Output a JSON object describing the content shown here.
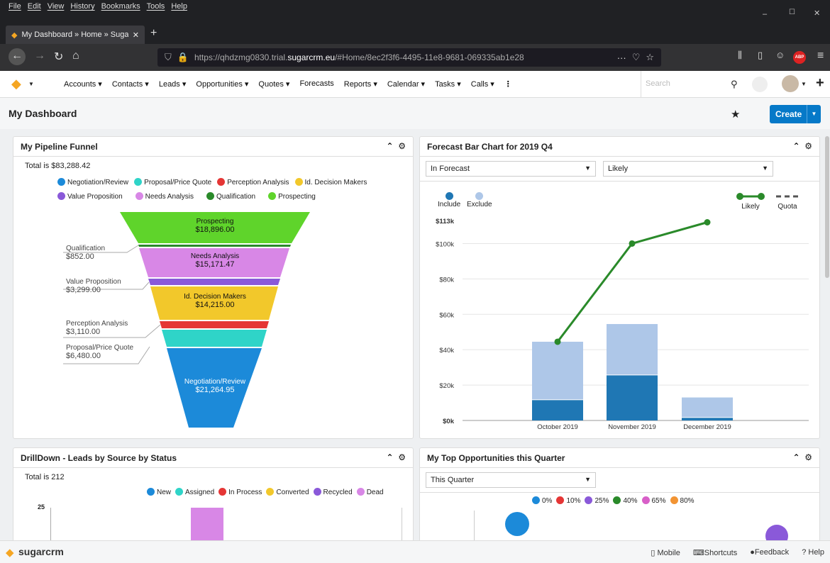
{
  "browser": {
    "menu": [
      "File",
      "Edit",
      "View",
      "History",
      "Bookmarks",
      "Tools",
      "Help"
    ],
    "tab_title": "My Dashboard » Home » Sugar",
    "url_prefix": "https://qhdzmg0830.trial.",
    "url_host": "sugarcrm.eu",
    "url_rest": "/#Home/8ec2f3f6-4495-11e8-9681-069335ab1e28",
    "extra_icon": "ABP"
  },
  "nav": {
    "modules": [
      "Accounts ▾",
      "Contacts ▾",
      "Leads ▾",
      "Opportunities ▾",
      "Quotes ▾",
      "Forecasts",
      "Reports ▾",
      "Calendar ▾",
      "Tasks ▾",
      "Calls ▾",
      "⋮"
    ],
    "search_placeholder": "Search"
  },
  "page": {
    "title": "My Dashboard",
    "create_label": "Create"
  },
  "funnel": {
    "title": "My Pipeline Funnel",
    "total": "Total is $83,288.42",
    "legend_row1": [
      {
        "label": "Negotiation/Review",
        "color": "#1c8ad9"
      },
      {
        "label": "Proposal/Price Quote",
        "color": "#2fd4c8"
      },
      {
        "label": "Perception Analysis",
        "color": "#e53635"
      },
      {
        "label": "Id. Decision Makers",
        "color": "#f2c82b"
      }
    ],
    "legend_row2": [
      {
        "label": "Value Proposition",
        "color": "#8a59d9"
      },
      {
        "label": "Needs Analysis",
        "color": "#d887e6"
      },
      {
        "label": "Qualification",
        "color": "#2a8a2a"
      },
      {
        "label": "Prospecting",
        "color": "#5fd42b"
      }
    ],
    "stages": [
      {
        "name": "Prospecting",
        "value": "$18,896.00"
      },
      {
        "name": "Qualification",
        "value": "$852.00"
      },
      {
        "name": "Needs Analysis",
        "value": "$15,171.47"
      },
      {
        "name": "Value Proposition",
        "value": "$3,299.00"
      },
      {
        "name": "Id. Decision Makers",
        "value": "$14,215.00"
      },
      {
        "name": "Perception Analysis",
        "value": "$3,110.00"
      },
      {
        "name": "Proposal/Price Quote",
        "value": "$6,480.00"
      },
      {
        "name": "Negotiation/Review",
        "value": "$21,264.95"
      }
    ]
  },
  "forecast": {
    "title": "Forecast Bar Chart for 2019 Q4",
    "filter1": "In Forecast",
    "filter2": "Likely",
    "legend_include": "Include",
    "legend_exclude": "Exclude",
    "legend_likely": "Likely",
    "legend_quota": "Quota"
  },
  "chart_data": {
    "type": "bar",
    "categories": [
      "October 2019",
      "November 2019",
      "December 2019"
    ],
    "series": [
      {
        "name": "Include",
        "values": [
          11500,
          25500,
          1500
        ],
        "color": "#1f77b4"
      },
      {
        "name": "Exclude",
        "values": [
          33000,
          29000,
          11500
        ],
        "color": "#aec7e8"
      },
      {
        "name": "Likely",
        "type": "line",
        "values": [
          44500,
          100000,
          112000
        ],
        "color": "#2a8a2a"
      }
    ],
    "yticks": [
      "$0k",
      "$20k",
      "$40k",
      "$60k",
      "$80k",
      "$100k",
      "$113k"
    ],
    "ylim": [
      0,
      113000
    ],
    "stacked": true
  },
  "drilldown": {
    "title": "DrillDown - Leads by Source by Status",
    "total": "Total is 212",
    "legend": [
      {
        "label": "New",
        "color": "#1c8ad9"
      },
      {
        "label": "Assigned",
        "color": "#2fd4c8"
      },
      {
        "label": "In Process",
        "color": "#e53635"
      },
      {
        "label": "Converted",
        "color": "#f2c82b"
      },
      {
        "label": "Recycled",
        "color": "#8a59d9"
      },
      {
        "label": "Dead",
        "color": "#d887e6"
      }
    ],
    "ytick_top": "25"
  },
  "topopps": {
    "title": "My Top Opportunities this Quarter",
    "filter": "This Quarter",
    "legend": [
      {
        "label": "0%",
        "color": "#1c8ad9"
      },
      {
        "label": "10%",
        "color": "#e53635"
      },
      {
        "label": "25%",
        "color": "#8a59d9"
      },
      {
        "label": "40%",
        "color": "#2a8a2a"
      },
      {
        "label": "65%",
        "color": "#d85fc8"
      },
      {
        "label": "80%",
        "color": "#f29433"
      }
    ]
  },
  "footer": {
    "brand": "sugarcrm",
    "mobile": "Mobile",
    "shortcuts": "Shortcuts",
    "feedback": "Feedback",
    "help": "Help"
  }
}
